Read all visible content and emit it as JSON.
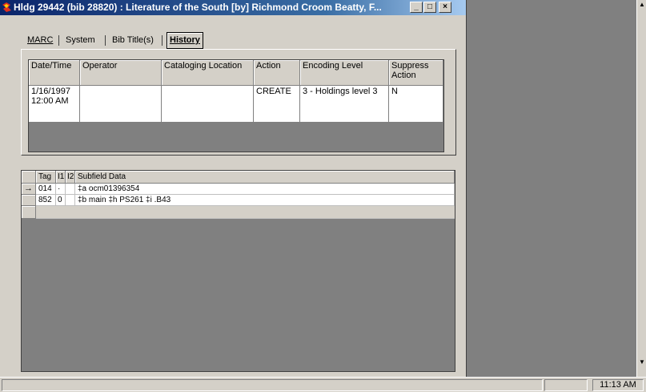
{
  "window": {
    "title": "Hldg 29442 (bib 28820) : Literature of the South [by] Richmond Croom Beatty, F...",
    "minimize_label": "_",
    "maximize_label": "□",
    "close_label": "×"
  },
  "tabs": [
    {
      "label": "MARC"
    },
    {
      "label": "System"
    },
    {
      "label": "Bib Title(s)"
    },
    {
      "label": "History"
    }
  ],
  "history_table": {
    "columns": [
      "Date/Time",
      "Operator",
      "Cataloging Location",
      "Action",
      "Encoding Level",
      "Suppress Action"
    ],
    "rows": [
      [
        "1/16/1997 12:00 AM",
        "",
        "",
        "CREATE",
        "3 - Holdings level 3",
        "N"
      ]
    ]
  },
  "marc_grid": {
    "columns": [
      "Tag",
      "I1",
      "I2",
      "Subfield Data"
    ],
    "row_pointer": "→",
    "rows": [
      {
        "tag": "014",
        "i1": "·",
        "i2": "",
        "data": "‡a ocm01396354"
      },
      {
        "tag": "852",
        "i1": "0",
        "i2": "",
        "data": "‡b main ‡h PS261 ‡i .B43"
      }
    ]
  },
  "statusbar": {
    "clock": "11:13 AM"
  },
  "colors": {
    "titlebar": "#0a246a",
    "window_face": "#d4d0c8",
    "desktop": "#808080"
  }
}
